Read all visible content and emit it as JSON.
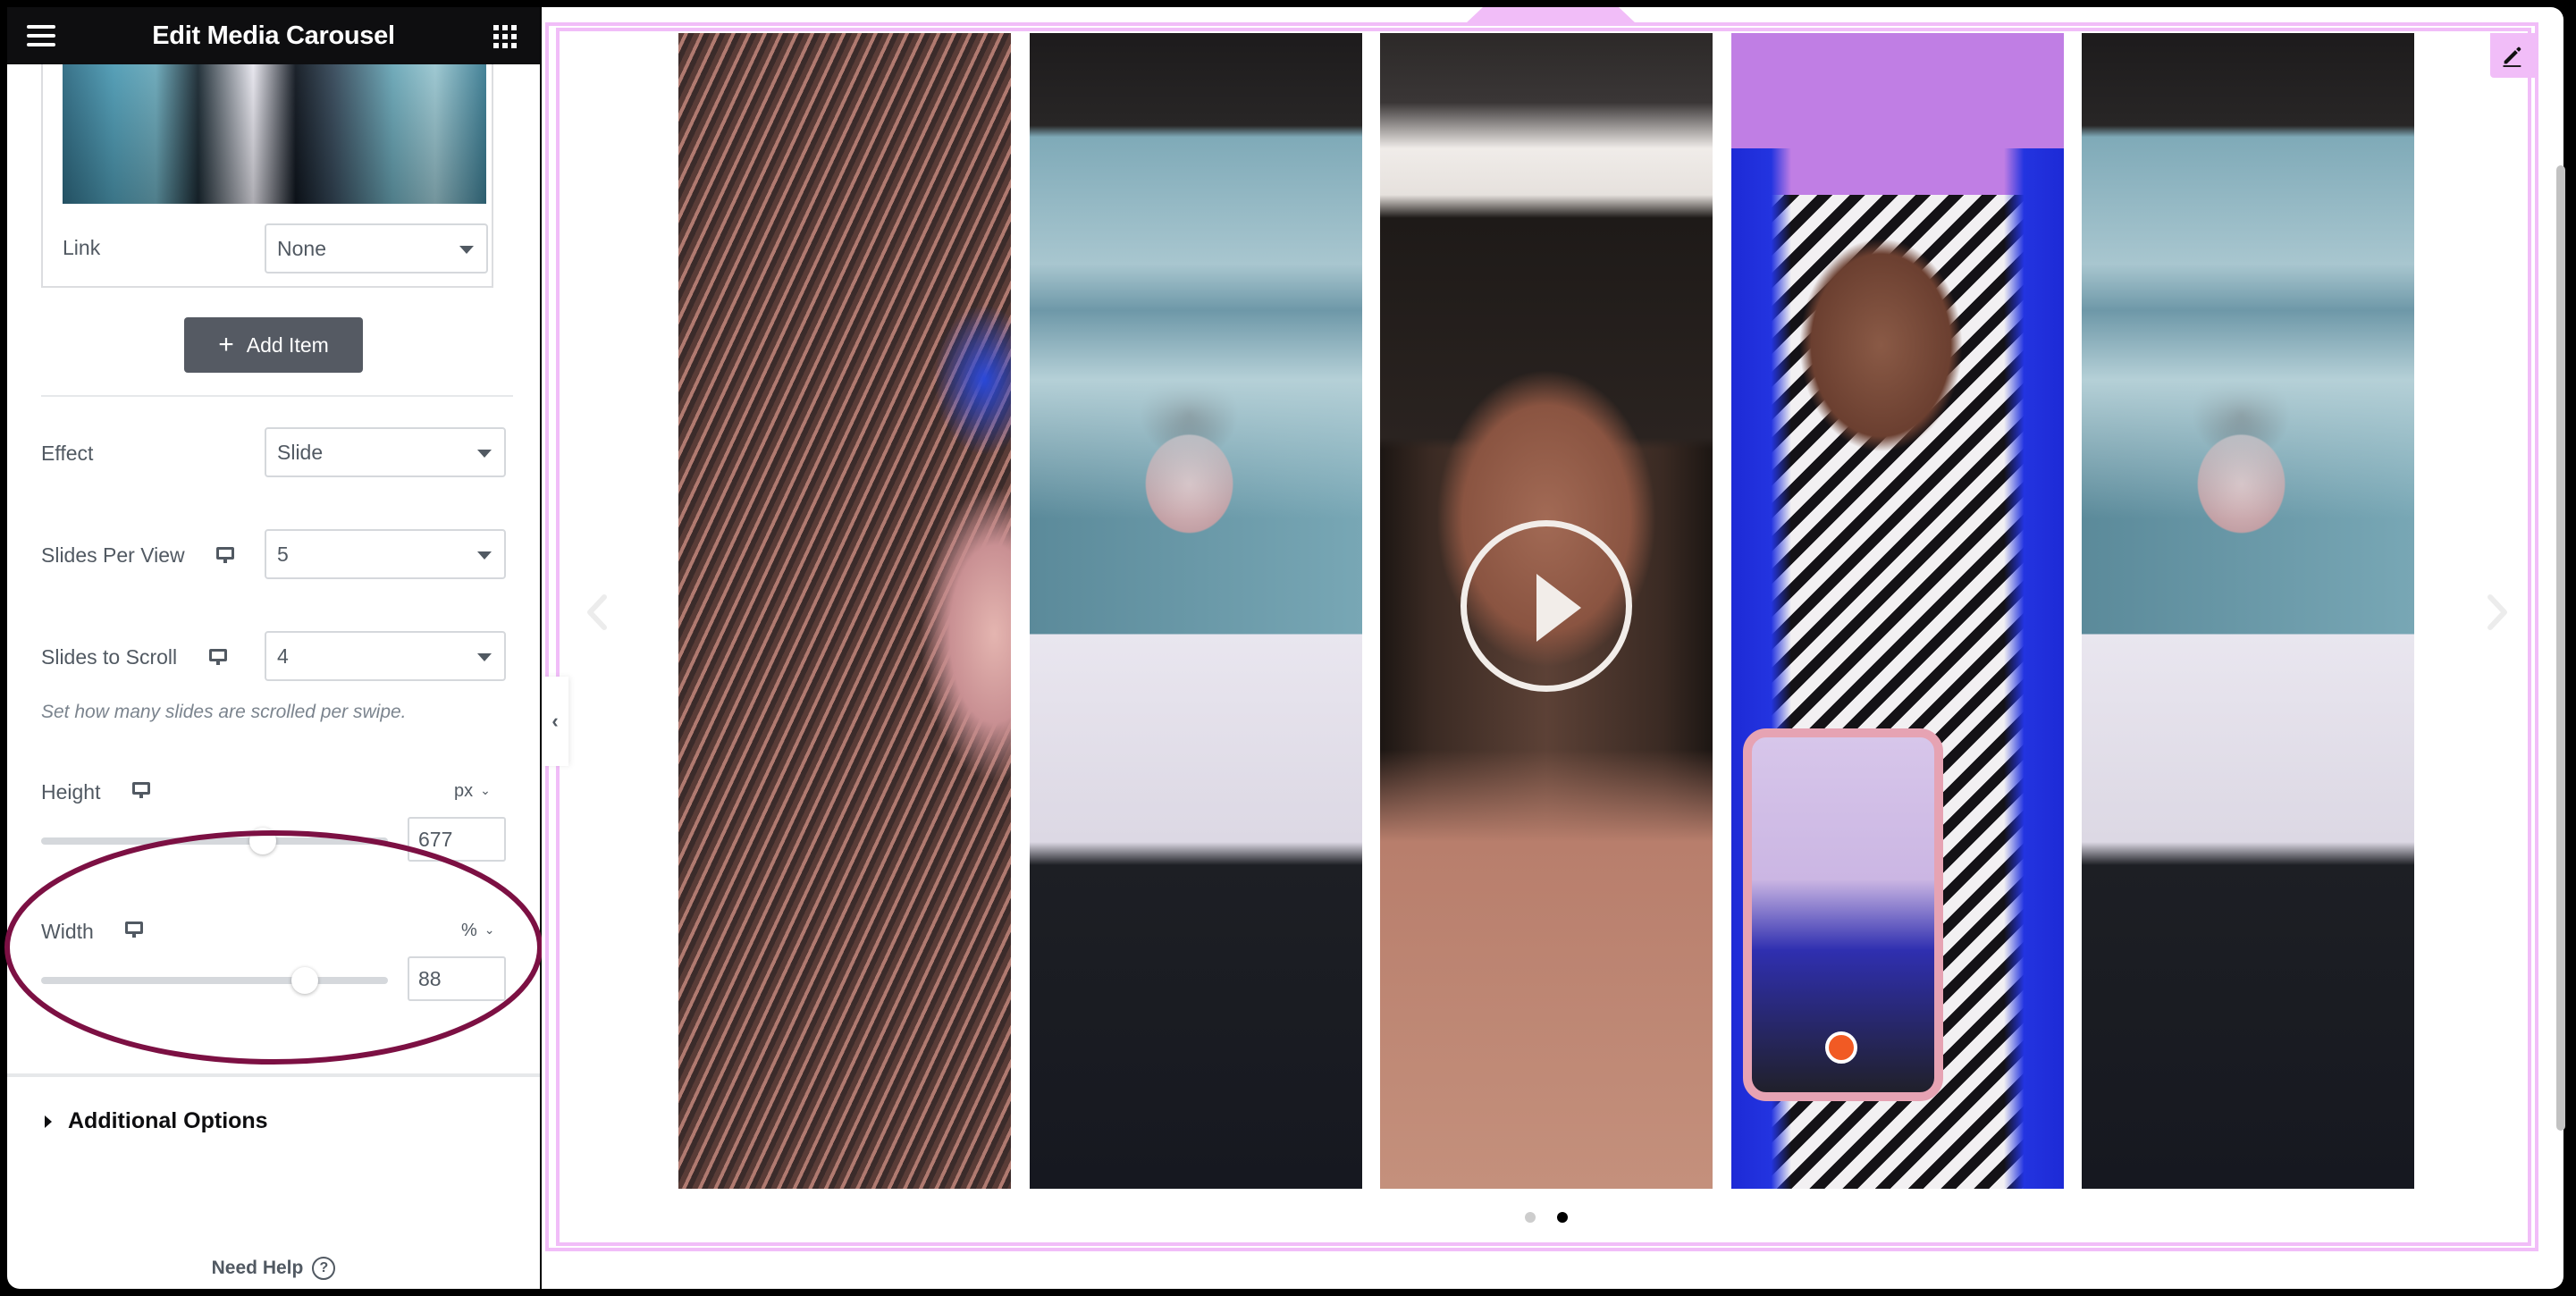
{
  "panel": {
    "title": "Edit Media Carousel",
    "menu_icon": "hamburger-menu-icon",
    "apps_icon": "grid-apps-icon",
    "item": {
      "link_label": "Link",
      "link_value": "None"
    },
    "add_item_label": "Add Item",
    "controls": {
      "effect": {
        "label": "Effect",
        "value": "Slide"
      },
      "slides_per_view": {
        "label": "Slides Per View",
        "value": "5",
        "device_icon": "desktop-monitor-icon"
      },
      "slides_to_scroll": {
        "label": "Slides to Scroll",
        "value": "4",
        "device_icon": "desktop-monitor-icon",
        "hint": "Set how many slides are scrolled per swipe."
      },
      "height": {
        "label": "Height",
        "unit": "px",
        "value": "677",
        "slider_fraction": 0.64
      },
      "width": {
        "label": "Width",
        "unit": "%",
        "value": "88",
        "slider_fraction": 0.76
      }
    },
    "additional_options_label": "Additional Options",
    "need_help_label": "Need Help",
    "collapse_icon": "chevron-left-icon"
  },
  "canvas": {
    "accent_color": "#f1bdf8",
    "edit_icon": "pencil-icon",
    "slides": [
      {
        "index": 1,
        "type": "image"
      },
      {
        "index": 2,
        "type": "image"
      },
      {
        "index": 3,
        "type": "video"
      },
      {
        "index": 4,
        "type": "image"
      },
      {
        "index": 5,
        "type": "image"
      }
    ],
    "pagination": {
      "total": 2,
      "active": 2
    }
  },
  "annotation": {
    "color": "#7c1043",
    "highlighted_control": "width"
  }
}
